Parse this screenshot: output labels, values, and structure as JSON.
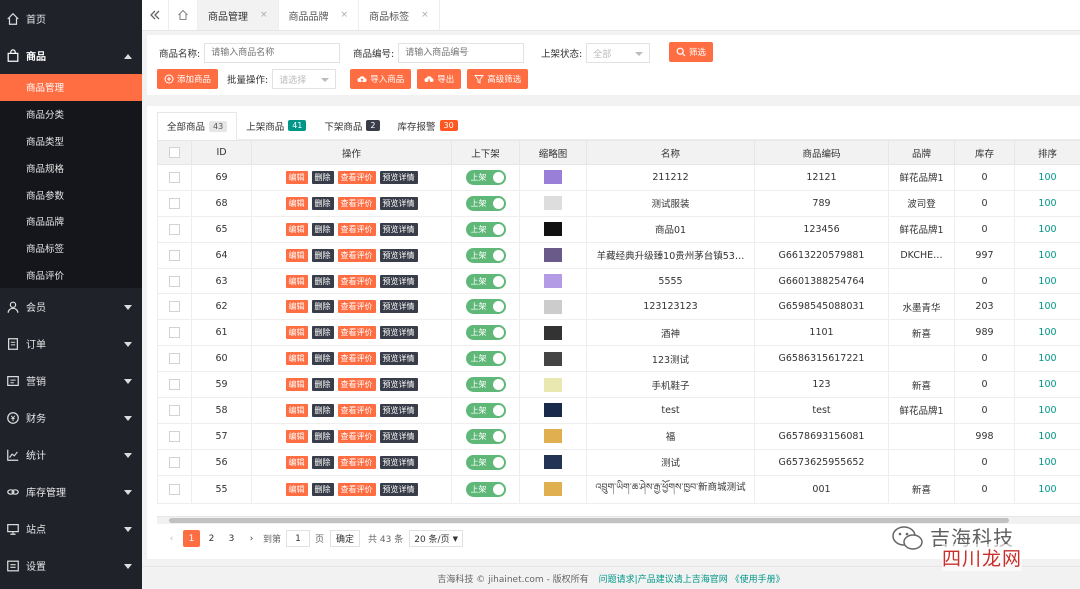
{
  "sidebar": {
    "items": [
      {
        "label": "首页",
        "icon": "home-icon"
      },
      {
        "label": "商品",
        "icon": "bag-icon",
        "open": true
      },
      {
        "label": "会员",
        "icon": "user-icon"
      },
      {
        "label": "订单",
        "icon": "order-icon"
      },
      {
        "label": "营销",
        "icon": "marketing-icon"
      },
      {
        "label": "财务",
        "icon": "finance-icon"
      },
      {
        "label": "统计",
        "icon": "chart-icon"
      },
      {
        "label": "库存管理",
        "icon": "link-icon"
      },
      {
        "label": "站点",
        "icon": "site-icon"
      },
      {
        "label": "设置",
        "icon": "settings-icon"
      }
    ],
    "sub_items": [
      "商品管理",
      "商品分类",
      "商品类型",
      "商品规格",
      "商品参数",
      "商品品牌",
      "商品标签",
      "商品评价"
    ],
    "active_sub": "商品管理"
  },
  "topbar": {
    "tabs": [
      {
        "label": "商品管理",
        "close": "×"
      },
      {
        "label": "商品品牌",
        "close": "×"
      },
      {
        "label": "商品标签",
        "close": "×"
      }
    ]
  },
  "filter": {
    "name_label": "商品名称:",
    "name_placeholder": "请输入商品名称",
    "code_label": "商品编号:",
    "code_placeholder": "请输入商品编号",
    "status_label": "上架状态:",
    "status_value": "全部",
    "search_button": "筛选",
    "add_button": "添加商品",
    "batch_label": "批量操作:",
    "batch_value": "请选择",
    "import_button": "导入商品",
    "export_button": "导出",
    "advanced_button": "高级筛选"
  },
  "list_tabs": [
    {
      "label": "全部商品",
      "count": "43"
    },
    {
      "label": "上架商品",
      "count": "41"
    },
    {
      "label": "下架商品",
      "count": "2"
    },
    {
      "label": "库存报警",
      "count": "30"
    }
  ],
  "table": {
    "columns": [
      "ID",
      "操作",
      "上下架",
      "缩略图",
      "名称",
      "商品编码",
      "品牌",
      "库存",
      "排序"
    ],
    "actions": [
      "编辑",
      "删除",
      "查看评价",
      "预览详情"
    ],
    "switch_label": "上架",
    "rows": [
      {
        "id": "69",
        "name": "211212",
        "code": "12121",
        "brand": "鲜花品牌1",
        "stock": "0",
        "sort": "100"
      },
      {
        "id": "68",
        "name": "测试服装",
        "code": "789",
        "brand": "波司登",
        "stock": "0",
        "sort": "100"
      },
      {
        "id": "65",
        "name": "商品01",
        "code": "123456",
        "brand": "鲜花品牌1",
        "stock": "0",
        "sort": "100"
      },
      {
        "id": "64",
        "name": "羊藏经典升级臻10贵州茅台镇53…",
        "code": "G6613220579881",
        "brand": "DKCHE…",
        "stock": "997",
        "sort": "100"
      },
      {
        "id": "63",
        "name": "5555",
        "code": "G6601388254764",
        "brand": "",
        "stock": "0",
        "sort": "100"
      },
      {
        "id": "62",
        "name": "123123123",
        "code": "G6598545088031",
        "brand": "水墨青华",
        "stock": "203",
        "sort": "100"
      },
      {
        "id": "61",
        "name": "酒神",
        "code": "1101",
        "brand": "新喜",
        "stock": "989",
        "sort": "100"
      },
      {
        "id": "60",
        "name": "123测试",
        "code": "G6586315617221",
        "brand": "",
        "stock": "0",
        "sort": "100"
      },
      {
        "id": "59",
        "name": "手机鞋子",
        "code": "123",
        "brand": "新喜",
        "stock": "0",
        "sort": "100"
      },
      {
        "id": "58",
        "name": "test",
        "code": "test",
        "brand": "鲜花品牌1",
        "stock": "0",
        "sort": "100"
      },
      {
        "id": "57",
        "name": "福",
        "code": "G6578693156081",
        "brand": "",
        "stock": "998",
        "sort": "100"
      },
      {
        "id": "56",
        "name": "测试",
        "code": "G6573625955652",
        "brand": "",
        "stock": "0",
        "sort": "100"
      },
      {
        "id": "55",
        "name": "འབྲུག་ཡིག་ཆ་ཤེས་རྒྱ་ཕྱོགས་ཁྱབ་新商城测试",
        "code": "001",
        "brand": "新喜",
        "stock": "0",
        "sort": "100"
      }
    ],
    "thumb_colors": [
      "#9a7fd8",
      "#dddddd",
      "#111111",
      "#6a5a8a",
      "#b49be6",
      "#cccccc",
      "#333333",
      "#444444",
      "#e8e8b0",
      "#1a2a4a",
      "#e0b050",
      "#223355",
      "#e0b050"
    ]
  },
  "pager": {
    "pages": [
      "1",
      "2",
      "3"
    ],
    "goto_label": "到第",
    "goto_value": "1",
    "page_unit": "页",
    "confirm": "确定",
    "total": "共 43 条",
    "per_page": "20 条/页"
  },
  "footer": {
    "copyright": "吉海科技 © jihainet.com - 版权所有",
    "links": "问题请求|产品建议请上吉海官网 《使用手册》"
  },
  "watermark": {
    "line1": "吉海科技",
    "line2": "四川龙网"
  }
}
